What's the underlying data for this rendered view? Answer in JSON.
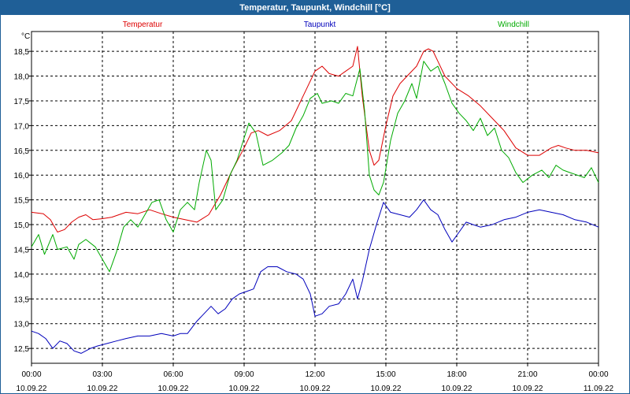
{
  "window": {
    "title": "Temperatur, Taupunkt, Windchill [°C]"
  },
  "chart_data": {
    "type": "line",
    "title": "Temperatur, Taupunkt, Windchill [°C]",
    "ylabel": "°C",
    "ylim": [
      12.2,
      18.9
    ],
    "yticks": [
      12.5,
      13.0,
      13.5,
      14.0,
      14.5,
      15.0,
      15.5,
      16.0,
      16.5,
      17.0,
      17.5,
      18.0,
      18.5
    ],
    "ytick_labels": [
      "12,5",
      "13,0",
      "13,5",
      "14,0",
      "14,5",
      "15,0",
      "15,5",
      "16,0",
      "16,5",
      "17,0",
      "17,5",
      "18,0",
      "18,5"
    ],
    "xlim": [
      0,
      24
    ],
    "xticks": [
      {
        "h": 0,
        "time": "00:00",
        "date": "10.09.22"
      },
      {
        "h": 3,
        "time": "03:00",
        "date": "10.09.22"
      },
      {
        "h": 6,
        "time": "06:00",
        "date": "10.09.22"
      },
      {
        "h": 9,
        "time": "09:00",
        "date": "10.09.22"
      },
      {
        "h": 12,
        "time": "12:00",
        "date": "10.09.22"
      },
      {
        "h": 15,
        "time": "15:00",
        "date": "10.09.22"
      },
      {
        "h": 18,
        "time": "18:00",
        "date": "10.09.22"
      },
      {
        "h": 21,
        "time": "21:00",
        "date": "10.09.22"
      },
      {
        "h": 24,
        "time": "00:00",
        "date": "11.09.22"
      }
    ],
    "grid": true,
    "legend_placement": "top",
    "series": [
      {
        "name": "Temperatur",
        "color": "#dd0000",
        "points": [
          [
            0,
            15.25
          ],
          [
            0.5,
            15.22
          ],
          [
            0.8,
            15.1
          ],
          [
            1.1,
            14.85
          ],
          [
            1.4,
            14.9
          ],
          [
            1.7,
            15.05
          ],
          [
            2.0,
            15.15
          ],
          [
            2.3,
            15.2
          ],
          [
            2.6,
            15.1
          ],
          [
            3.0,
            15.12
          ],
          [
            3.4,
            15.15
          ],
          [
            3.7,
            15.2
          ],
          [
            4.0,
            15.25
          ],
          [
            4.5,
            15.22
          ],
          [
            5.0,
            15.3
          ],
          [
            5.5,
            15.22
          ],
          [
            6.0,
            15.15
          ],
          [
            6.5,
            15.1
          ],
          [
            7.0,
            15.05
          ],
          [
            7.5,
            15.2
          ],
          [
            8.0,
            15.6
          ],
          [
            8.5,
            16.1
          ],
          [
            9.0,
            16.55
          ],
          [
            9.3,
            16.85
          ],
          [
            9.6,
            16.9
          ],
          [
            10.0,
            16.8
          ],
          [
            10.5,
            16.9
          ],
          [
            11.0,
            17.1
          ],
          [
            11.5,
            17.6
          ],
          [
            12.0,
            18.1
          ],
          [
            12.3,
            18.2
          ],
          [
            12.6,
            18.05
          ],
          [
            13.0,
            18.0
          ],
          [
            13.3,
            18.1
          ],
          [
            13.6,
            18.2
          ],
          [
            13.8,
            18.6
          ],
          [
            14.0,
            17.6
          ],
          [
            14.3,
            16.5
          ],
          [
            14.5,
            16.2
          ],
          [
            14.7,
            16.3
          ],
          [
            15.0,
            17.0
          ],
          [
            15.3,
            17.6
          ],
          [
            15.6,
            17.85
          ],
          [
            16.0,
            18.05
          ],
          [
            16.3,
            18.2
          ],
          [
            16.6,
            18.5
          ],
          [
            16.8,
            18.55
          ],
          [
            17.0,
            18.5
          ],
          [
            17.2,
            18.3
          ],
          [
            17.5,
            18.0
          ],
          [
            18.0,
            17.75
          ],
          [
            18.5,
            17.6
          ],
          [
            19.0,
            17.4
          ],
          [
            19.5,
            17.15
          ],
          [
            20.0,
            16.9
          ],
          [
            20.5,
            16.55
          ],
          [
            21.0,
            16.4
          ],
          [
            21.5,
            16.4
          ],
          [
            22.0,
            16.55
          ],
          [
            22.3,
            16.6
          ],
          [
            22.6,
            16.55
          ],
          [
            23.0,
            16.5
          ],
          [
            23.5,
            16.5
          ],
          [
            24.0,
            16.45
          ]
        ]
      },
      {
        "name": "Taupunkt",
        "color": "#0000bb",
        "points": [
          [
            0,
            12.85
          ],
          [
            0.3,
            12.8
          ],
          [
            0.6,
            12.7
          ],
          [
            0.9,
            12.5
          ],
          [
            1.2,
            12.65
          ],
          [
            1.5,
            12.6
          ],
          [
            1.8,
            12.45
          ],
          [
            2.1,
            12.4
          ],
          [
            2.5,
            12.5
          ],
          [
            2.8,
            12.55
          ],
          [
            3.2,
            12.6
          ],
          [
            3.6,
            12.65
          ],
          [
            4.0,
            12.7
          ],
          [
            4.5,
            12.75
          ],
          [
            5.0,
            12.75
          ],
          [
            5.5,
            12.8
          ],
          [
            6.0,
            12.75
          ],
          [
            6.3,
            12.8
          ],
          [
            6.6,
            12.8
          ],
          [
            7.0,
            13.05
          ],
          [
            7.3,
            13.2
          ],
          [
            7.6,
            13.35
          ],
          [
            7.9,
            13.2
          ],
          [
            8.2,
            13.3
          ],
          [
            8.5,
            13.5
          ],
          [
            8.8,
            13.6
          ],
          [
            9.1,
            13.65
          ],
          [
            9.4,
            13.7
          ],
          [
            9.7,
            14.05
          ],
          [
            10.0,
            14.15
          ],
          [
            10.4,
            14.15
          ],
          [
            10.8,
            14.05
          ],
          [
            11.2,
            14.0
          ],
          [
            11.5,
            13.9
          ],
          [
            11.8,
            13.6
          ],
          [
            12.0,
            13.15
          ],
          [
            12.3,
            13.2
          ],
          [
            12.6,
            13.35
          ],
          [
            13.0,
            13.4
          ],
          [
            13.3,
            13.6
          ],
          [
            13.6,
            13.9
          ],
          [
            13.8,
            13.5
          ],
          [
            14.0,
            13.85
          ],
          [
            14.3,
            14.5
          ],
          [
            14.6,
            15.0
          ],
          [
            14.9,
            15.45
          ],
          [
            15.2,
            15.25
          ],
          [
            15.6,
            15.2
          ],
          [
            16.0,
            15.15
          ],
          [
            16.3,
            15.3
          ],
          [
            16.6,
            15.5
          ],
          [
            16.9,
            15.3
          ],
          [
            17.2,
            15.2
          ],
          [
            17.5,
            14.9
          ],
          [
            17.8,
            14.65
          ],
          [
            18.1,
            14.85
          ],
          [
            18.4,
            15.05
          ],
          [
            18.7,
            15.0
          ],
          [
            19.0,
            14.95
          ],
          [
            19.5,
            15.0
          ],
          [
            20.0,
            15.1
          ],
          [
            20.5,
            15.15
          ],
          [
            21.0,
            15.25
          ],
          [
            21.5,
            15.3
          ],
          [
            22.0,
            15.25
          ],
          [
            22.5,
            15.2
          ],
          [
            23.0,
            15.1
          ],
          [
            23.5,
            15.05
          ],
          [
            24.0,
            14.95
          ]
        ]
      },
      {
        "name": "Windchill",
        "color": "#00aa00",
        "points": [
          [
            0,
            14.55
          ],
          [
            0.3,
            14.8
          ],
          [
            0.55,
            14.4
          ],
          [
            0.9,
            14.8
          ],
          [
            1.1,
            14.5
          ],
          [
            1.5,
            14.55
          ],
          [
            1.8,
            14.3
          ],
          [
            2.0,
            14.6
          ],
          [
            2.3,
            14.7
          ],
          [
            2.7,
            14.55
          ],
          [
            3.0,
            14.3
          ],
          [
            3.3,
            14.05
          ],
          [
            3.6,
            14.45
          ],
          [
            3.9,
            14.95
          ],
          [
            4.2,
            15.1
          ],
          [
            4.5,
            14.95
          ],
          [
            4.8,
            15.2
          ],
          [
            5.1,
            15.45
          ],
          [
            5.4,
            15.5
          ],
          [
            5.7,
            15.1
          ],
          [
            6.0,
            14.85
          ],
          [
            6.3,
            15.3
          ],
          [
            6.6,
            15.45
          ],
          [
            6.9,
            15.3
          ],
          [
            7.1,
            15.85
          ],
          [
            7.4,
            16.5
          ],
          [
            7.6,
            16.3
          ],
          [
            7.8,
            15.3
          ],
          [
            8.1,
            15.5
          ],
          [
            8.4,
            16.0
          ],
          [
            8.7,
            16.3
          ],
          [
            9.0,
            16.75
          ],
          [
            9.2,
            17.05
          ],
          [
            9.5,
            16.85
          ],
          [
            9.8,
            16.2
          ],
          [
            10.2,
            16.3
          ],
          [
            10.6,
            16.45
          ],
          [
            10.9,
            16.6
          ],
          [
            11.2,
            16.95
          ],
          [
            11.5,
            17.2
          ],
          [
            11.8,
            17.55
          ],
          [
            12.1,
            17.65
          ],
          [
            12.3,
            17.45
          ],
          [
            12.7,
            17.5
          ],
          [
            13.0,
            17.45
          ],
          [
            13.3,
            17.65
          ],
          [
            13.6,
            17.6
          ],
          [
            13.9,
            18.15
          ],
          [
            14.1,
            17.3
          ],
          [
            14.3,
            16.0
          ],
          [
            14.5,
            15.7
          ],
          [
            14.7,
            15.6
          ],
          [
            14.9,
            15.85
          ],
          [
            15.2,
            16.7
          ],
          [
            15.5,
            17.25
          ],
          [
            15.8,
            17.5
          ],
          [
            16.1,
            17.85
          ],
          [
            16.3,
            17.55
          ],
          [
            16.6,
            18.3
          ],
          [
            16.9,
            18.1
          ],
          [
            17.2,
            18.2
          ],
          [
            17.5,
            17.85
          ],
          [
            17.8,
            17.45
          ],
          [
            18.1,
            17.25
          ],
          [
            18.4,
            17.1
          ],
          [
            18.7,
            16.9
          ],
          [
            19.0,
            17.15
          ],
          [
            19.3,
            16.8
          ],
          [
            19.6,
            16.95
          ],
          [
            19.9,
            16.5
          ],
          [
            20.2,
            16.35
          ],
          [
            20.5,
            16.05
          ],
          [
            20.8,
            15.85
          ],
          [
            21.2,
            16.0
          ],
          [
            21.6,
            16.1
          ],
          [
            21.9,
            15.95
          ],
          [
            22.2,
            16.2
          ],
          [
            22.5,
            16.1
          ],
          [
            22.8,
            16.05
          ],
          [
            23.1,
            16.0
          ],
          [
            23.4,
            15.95
          ],
          [
            23.7,
            16.15
          ],
          [
            24.0,
            15.85
          ]
        ]
      }
    ]
  }
}
